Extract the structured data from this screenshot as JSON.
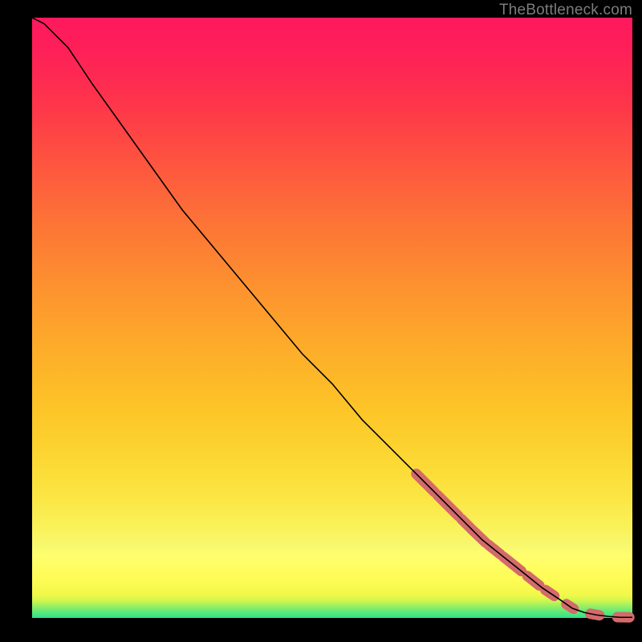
{
  "watermark": "TheBottleneck.com",
  "colors": {
    "line": "#000000",
    "marker": "#d46a6a",
    "gradient_top": "#ff195e",
    "gradient_bottom": "#2ce28d"
  },
  "chart_data": {
    "type": "line",
    "title": "",
    "xlabel": "",
    "ylabel": "",
    "xlim": [
      0,
      100
    ],
    "ylim": [
      0,
      100
    ],
    "series": [
      {
        "name": "curve",
        "x": [
          0,
          2,
          4,
          6,
          8,
          10,
          15,
          20,
          25,
          30,
          35,
          40,
          45,
          50,
          55,
          60,
          65,
          70,
          75,
          80,
          85,
          88,
          90,
          92,
          94,
          96,
          98,
          100
        ],
        "values": [
          100,
          99,
          97,
          95,
          92,
          89,
          82,
          75,
          68,
          62,
          56,
          50,
          44,
          39,
          33,
          28,
          23,
          18,
          13,
          9,
          5,
          3,
          1.6,
          0.9,
          0.5,
          0.25,
          0.1,
          0.1
        ]
      }
    ],
    "markers": {
      "note": "pill-shaped salmon markers drawn along the curve in the lower-right region",
      "segments": [
        {
          "x0": 64,
          "x1": 67
        },
        {
          "x0": 67.5,
          "x1": 71
        },
        {
          "x0": 71.5,
          "x1": 73
        },
        {
          "x0": 73.3,
          "x1": 75.5
        },
        {
          "x0": 76,
          "x1": 78
        },
        {
          "x0": 78.5,
          "x1": 81.5
        },
        {
          "x0": 82.5,
          "x1": 84.5
        },
        {
          "x0": 85.5,
          "x1": 87
        },
        {
          "x0": 89,
          "x1": 90.2
        },
        {
          "x0": 93,
          "x1": 94.5
        },
        {
          "x0": 97.5,
          "x1": 99.5
        }
      ]
    }
  }
}
